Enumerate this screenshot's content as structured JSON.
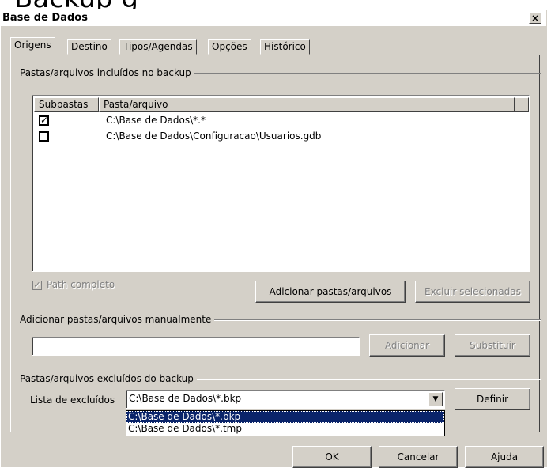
{
  "window": {
    "title": "Base de Dados",
    "close_glyph": "×"
  },
  "tabs": [
    {
      "label": "Origens",
      "active": true
    },
    {
      "label": "Destino",
      "active": false
    },
    {
      "label": "Tipos/Agendas",
      "active": false
    },
    {
      "label": "Opções",
      "active": false
    },
    {
      "label": "Histórico",
      "active": false
    }
  ],
  "included": {
    "group_label": "Pastas/arquivos incluídos no backup",
    "columns": [
      "Subpastas",
      "Pasta/arquivo"
    ],
    "rows": [
      {
        "subpastas_checked": true,
        "path": "C:\\Base de Dados\\*.*"
      },
      {
        "subpastas_checked": false,
        "path": "C:\\Base de Dados\\Configuracao\\Usuarios.gdb"
      }
    ],
    "path_completo_label": "Path completo",
    "path_completo_checked": true,
    "add_button": "Adicionar pastas/arquivos",
    "remove_button": "Excluir selecionadas"
  },
  "manual": {
    "group_label": "Adicionar pastas/arquivos manualmente",
    "input_value": "",
    "add_button": "Adicionar",
    "replace_button": "Substituir"
  },
  "excluded": {
    "group_label": "Pastas/arquivos excluídos do backup",
    "list_label": "Lista de excluídos",
    "selected_value": "C:\\Base de Dados\\*.bkp",
    "options": [
      "C:\\Base de Dados\\*.bkp",
      "C:\\Base de Dados\\*.tmp"
    ],
    "define_button": "Definir"
  },
  "footer": {
    "ok": "OK",
    "cancel": "Cancelar",
    "help": "Ajuda"
  }
}
